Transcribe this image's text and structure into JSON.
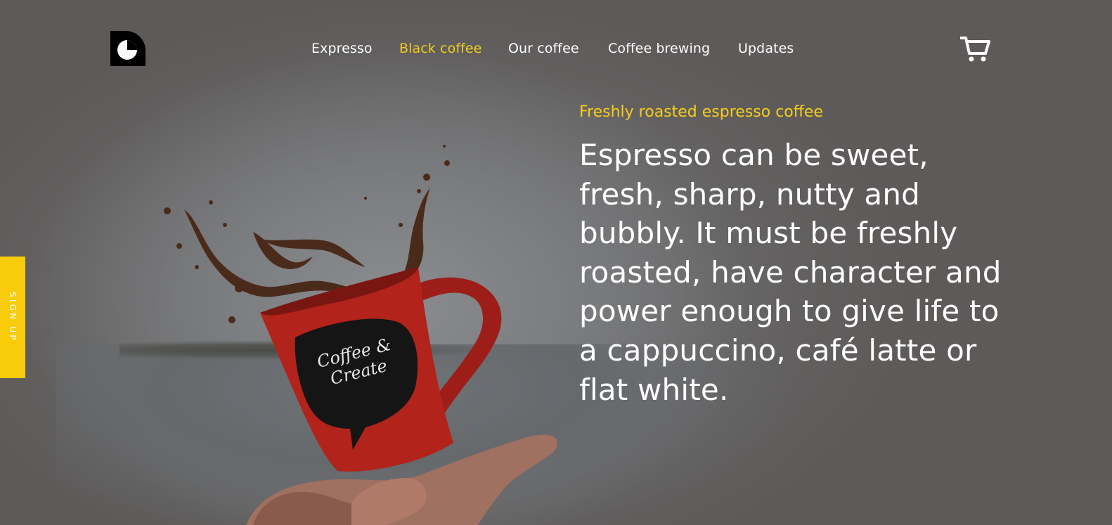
{
  "logo": {
    "icon": "logo-pie-icon"
  },
  "nav": {
    "items": [
      {
        "label": "Expresso",
        "active": false
      },
      {
        "label": "Black coffee",
        "active": true
      },
      {
        "label": "Our coffee",
        "active": false
      },
      {
        "label": "Coffee brewing",
        "active": false
      },
      {
        "label": "Updates",
        "active": false
      }
    ]
  },
  "cart": {
    "icon": "cart-icon"
  },
  "side": {
    "signup_label": "SIGN UP"
  },
  "hero": {
    "tagline": "Freshly roasted espresso coffee",
    "headline": "Espresso can be sweet, fresh, sharp, nutty and bubbly. It must be freshly roasted, have character and power enough to give life to a cappuccino, café latte or flat white.",
    "mug_text": "Coffee & Create"
  },
  "colors": {
    "background": "#5d5a59",
    "accent": "#f6cd1b",
    "signup": "#f8cc0b",
    "text": "#ffffff",
    "mug": "#b2231b"
  }
}
